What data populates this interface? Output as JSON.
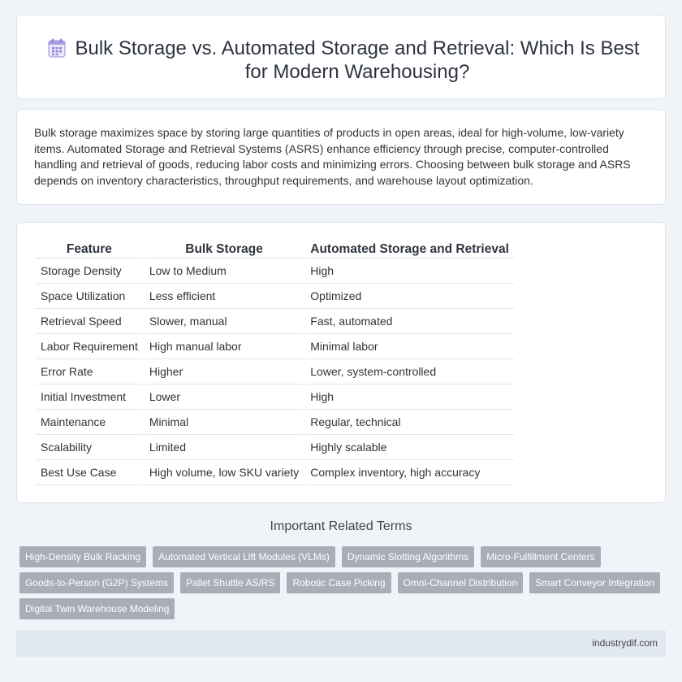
{
  "header": {
    "title": "Bulk Storage vs. Automated Storage and Retrieval: Which Is Best for Modern Warehousing?",
    "icon": "calendar-icon"
  },
  "intro": {
    "text": "Bulk storage maximizes space by storing large quantities of products in open areas, ideal for high-volume, low-variety items. Automated Storage and Retrieval Systems (ASRS) enhance efficiency through precise, computer-controlled handling and retrieval of goods, reducing labor costs and minimizing errors. Choosing between bulk storage and ASRS depends on inventory characteristics, throughput requirements, and warehouse layout optimization."
  },
  "table": {
    "headers": [
      "Feature",
      "Bulk Storage",
      "Automated Storage and Retrieval"
    ],
    "rows": [
      [
        "Storage Density",
        "Low to Medium",
        "High"
      ],
      [
        "Space Utilization",
        "Less efficient",
        "Optimized"
      ],
      [
        "Retrieval Speed",
        "Slower, manual",
        "Fast, automated"
      ],
      [
        "Labor Requirement",
        "High manual labor",
        "Minimal labor"
      ],
      [
        "Error Rate",
        "Higher",
        "Lower, system-controlled"
      ],
      [
        "Initial Investment",
        "Lower",
        "High"
      ],
      [
        "Maintenance",
        "Minimal",
        "Regular, technical"
      ],
      [
        "Scalability",
        "Limited",
        "Highly scalable"
      ],
      [
        "Best Use Case",
        "High volume, low SKU variety",
        "Complex inventory, high accuracy"
      ]
    ]
  },
  "related": {
    "heading": "Important Related Terms",
    "tags": [
      "High-Density Bulk Racking",
      "Automated Vertical Lift Modules (VLMs)",
      "Dynamic Slotting Algorithms",
      "Micro-Fulfillment Centers",
      "Goods-to-Person (G2P) Systems",
      "Pallet Shuttle AS/RS",
      "Robotic Case Picking",
      "Omni-Channel Distribution",
      "Smart Conveyor Integration",
      "Digital Twin Warehouse Modeling"
    ]
  },
  "footer": {
    "site": "industrydif.com"
  },
  "colors": {
    "background": "#f0f3f8",
    "tag": "#a8aeb8",
    "footer": "#e2e8f1",
    "icon": "#8b7fd6"
  }
}
